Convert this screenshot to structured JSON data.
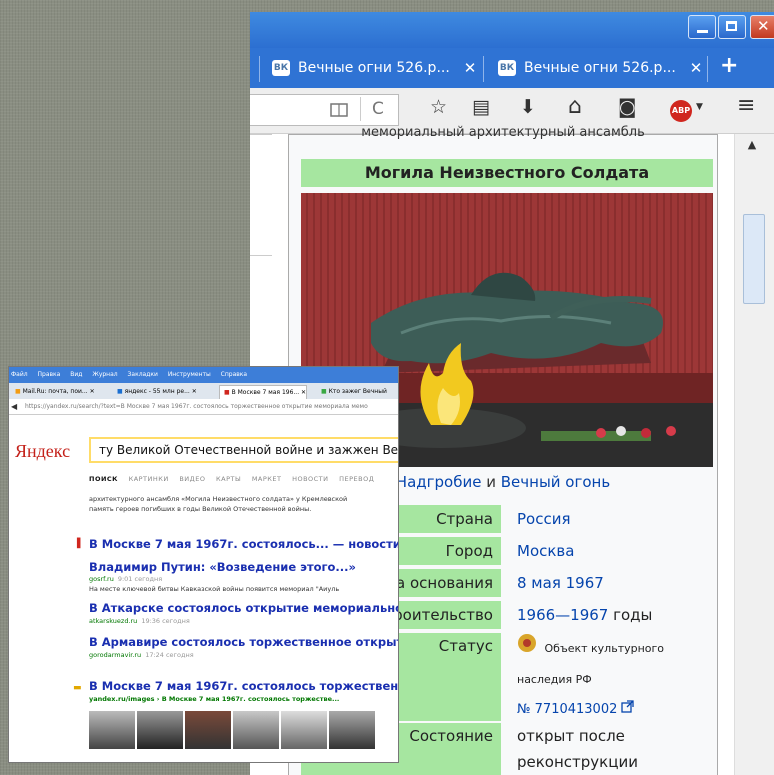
{
  "firefox": {
    "tabs": [
      {
        "icon": "ВК",
        "label": "Вечные огни 526.р...",
        "close": "✕"
      },
      {
        "icon": "ВК",
        "label": "Вечные огни 526.р...",
        "close": "✕"
      }
    ],
    "new_tab": "+",
    "toolbar": {
      "reader_icon": "reader-view-icon",
      "reload": "C",
      "star": "☆",
      "clipboard": "▤",
      "download": "⬇",
      "home": "⌂",
      "pocket": "◙",
      "abp": "ABP",
      "menu": "≡"
    }
  },
  "wiki": {
    "above_title": "мемориальный архитектурный ансамбль",
    "title": "Могила Неизвестного Солдата",
    "caption_link1": "Надгробие",
    "caption_and": " и ",
    "caption_link2": "Вечный огонь",
    "rows": [
      {
        "label": "Страна",
        "value": "Россия"
      },
      {
        "label": "Город",
        "value": "Москва"
      },
      {
        "label": "та основания",
        "value": "8 мая 1967"
      },
      {
        "label": "троительство",
        "value_link": "1966—1967",
        "value_text": " годы"
      },
      {
        "label": "Статус",
        "status_text1": "Объект культурного",
        "status_text2": "наследия РФ",
        "status_link": "№ 7710413002"
      },
      {
        "label": "Состояние",
        "value1": "открыт после",
        "value2": "реконструкции"
      }
    ]
  },
  "small": {
    "menu": [
      "Файл",
      "Правка",
      "Вид",
      "Журнал",
      "Закладки",
      "Инструменты",
      "Справка"
    ],
    "tabs": [
      "Mail.Ru: почта, пои...",
      "яндекс - 55 млн ре...",
      "В Москве 7 мая 196...",
      "Кто зажег Вечный"
    ],
    "address": "https://yandex.ru/search/?text=В Москве 7 мая 1967г. состоялось торжественное открытие мемориала мемо",
    "logo": "Яндекс",
    "query": "ту Великой Отечественной войне и зажжен Вечный ог",
    "nav": [
      "ПОИСК",
      "КАРТИНКИ",
      "ВИДЕО",
      "КАРТЫ",
      "МАРКЕТ",
      "НОВОСТИ",
      "ПЕРЕВОД"
    ],
    "snippet1": "архитектурного ансамбля «Могила Неизвестного солдата» у Кремлевской",
    "snippet2": "память героев погибших в годы Великой Отечественной войны.",
    "news_title": "В Москве 7 мая 1967г. состоялось... — новости",
    "r1_title": "Владимир Путин: «Возведение этого...»",
    "r1_url": "gosrf.ru",
    "r1_time": "9:01 сегодня",
    "r1_snip": "На месте ключевой битвы Кавказской войны появится мемориал \"Аиуль",
    "r2_title": "В Аткарске состоялось открытие мемориальной...",
    "r2_url": "atkarskuezd.ru",
    "r2_time": "19:36 сегодня",
    "r3_title": "В Армавире состоялось торжественное открытие...",
    "r3_url": "gorodarmavir.ru",
    "r3_time": "17:24 сегодня",
    "img_title": "В Москве 7 мая 1967г. состоялось торжественное",
    "img_url": "yandex.ru/images › В Москве 7 мая 1967г. состоялось торжестве..."
  }
}
